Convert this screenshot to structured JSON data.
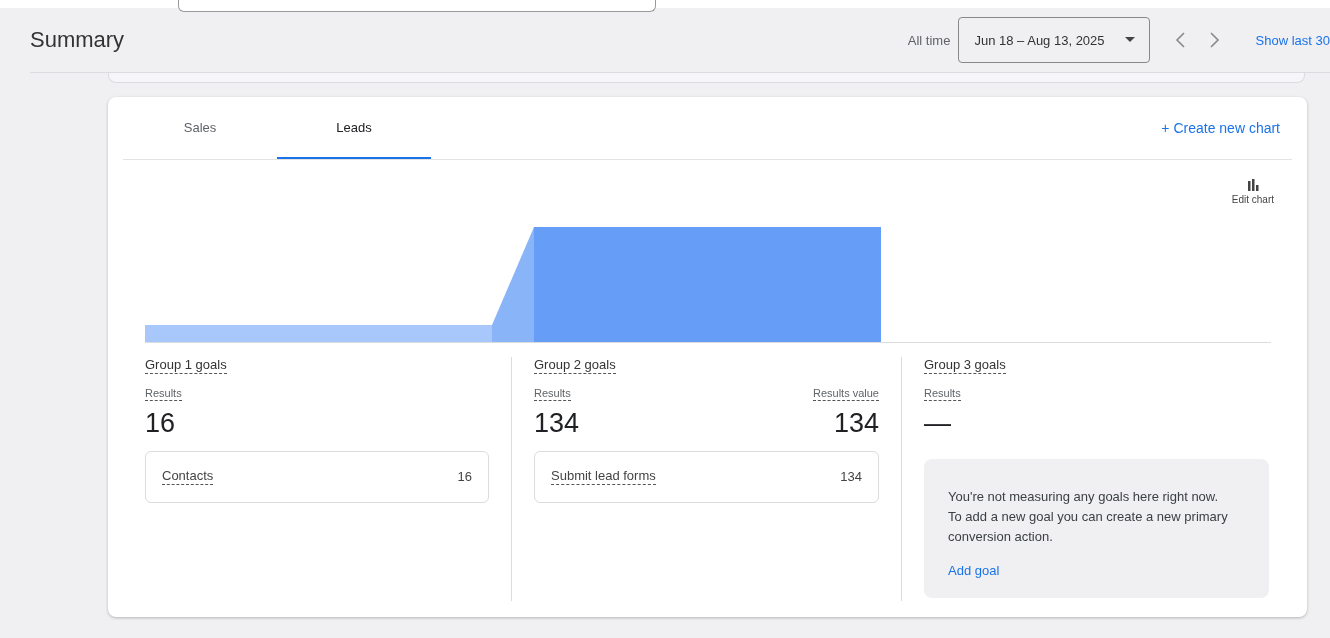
{
  "header": {
    "title": "Summary",
    "range_label": "All time",
    "date_range": "Jun 18 – Aug 13, 2025",
    "shortcut_link": "Show last 30"
  },
  "tabs": [
    {
      "label": "Sales",
      "selected": false
    },
    {
      "label": "Leads",
      "selected": true
    }
  ],
  "create_chart": {
    "icon": "+",
    "label": "Create new chart"
  },
  "edit_chart": {
    "label": "Edit chart"
  },
  "groups": [
    {
      "title": "Group 1 goals",
      "metrics": [
        {
          "label": "Results",
          "value": "16"
        }
      ],
      "items": [
        {
          "name": "Contacts",
          "value": "16"
        }
      ]
    },
    {
      "title": "Group 2 goals",
      "metrics": [
        {
          "label": "Results",
          "value": "134"
        },
        {
          "label": "Results value",
          "value": "134"
        }
      ],
      "items": [
        {
          "name": "Submit lead forms",
          "value": "134"
        }
      ]
    },
    {
      "title": "Group 3 goals",
      "metrics": [
        {
          "label": "Results",
          "value": "—"
        }
      ],
      "notice": {
        "text": "You're not measuring any goals here right now. To add a new goal you can create a new primary conversion action.",
        "link": "Add goal"
      }
    }
  ]
}
